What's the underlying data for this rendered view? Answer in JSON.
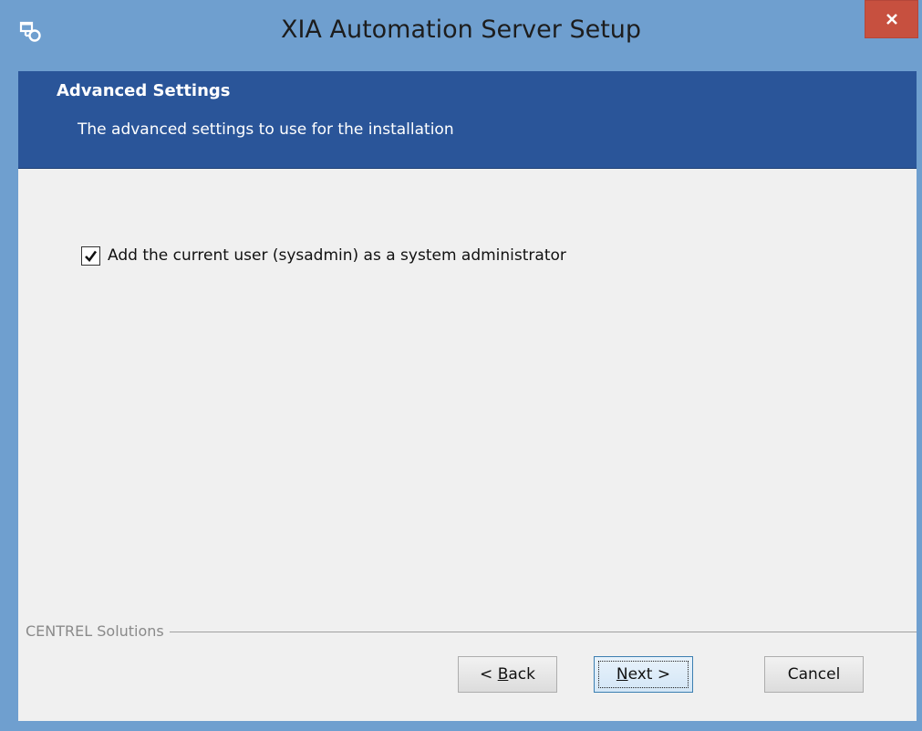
{
  "window": {
    "title": "XIA Automation Server Setup",
    "icon": "setup-app-icon",
    "close_icon": "close-icon",
    "close_color": "#c7503f"
  },
  "header": {
    "title": "Advanced Settings",
    "subtitle": "The advanced settings to use for the installation",
    "background_color": "#2a5599"
  },
  "options": {
    "add_admin": {
      "label": "Add the current user (sysadmin) as a system administrator",
      "checked": true
    }
  },
  "footer": {
    "group_label": "CENTREL Solutions"
  },
  "buttons": {
    "back_label": "< Back",
    "back_mnemonic": "B",
    "next_label": "Next >",
    "next_mnemonic": "N",
    "cancel_label": "Cancel"
  }
}
